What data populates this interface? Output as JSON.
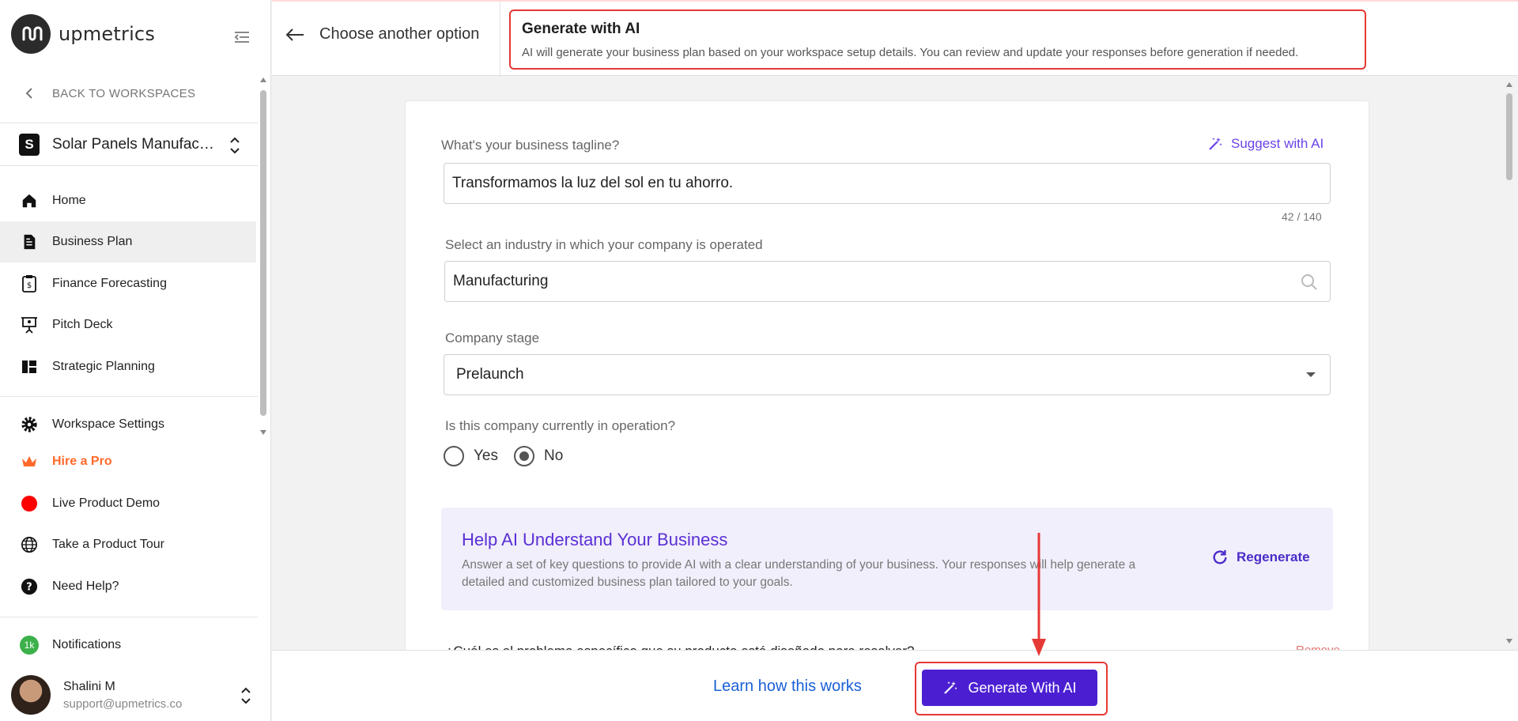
{
  "brand": {
    "name": "upmetrics"
  },
  "sidebar": {
    "back_label": "BACK TO WORKSPACES",
    "workspace": {
      "badge": "S",
      "name": "Solar Panels Manufacturing"
    },
    "items": [
      {
        "label": "Home",
        "icon": "home-icon"
      },
      {
        "label": "Business Plan",
        "icon": "document-icon",
        "active": true
      },
      {
        "label": "Finance Forecasting",
        "icon": "finance-icon"
      },
      {
        "label": "Pitch Deck",
        "icon": "presentation-icon"
      },
      {
        "label": "Strategic Planning",
        "icon": "dashboard-icon"
      }
    ],
    "secondary": [
      {
        "label": "Workspace Settings",
        "icon": "gear-icon"
      },
      {
        "label": "Hire a Pro",
        "icon": "crown-icon"
      },
      {
        "label": "Live Product Demo",
        "icon": "red-dot-icon"
      },
      {
        "label": "Take a Product Tour",
        "icon": "globe-icon"
      },
      {
        "label": "Need Help?",
        "icon": "help-icon"
      }
    ],
    "notifications": {
      "label": "Notifications",
      "badge": "1k"
    },
    "user": {
      "name": "Shalini M",
      "email": "support@upmetrics.co"
    }
  },
  "topbar": {
    "back_label": "Choose another option",
    "banner_title": "Generate with AI",
    "banner_desc": "AI will generate your business plan based on your workspace setup details. You can review and update your responses before generation if needed."
  },
  "form": {
    "tagline_label": "What's your business tagline?",
    "suggest_label": "Suggest with AI",
    "tagline_value": "Transformamos la luz del sol en tu ahorro.",
    "tagline_counter": "42 / 140",
    "industry_label": "Select an industry in which your company is operated",
    "industry_value": "Manufacturing",
    "stage_label": "Company stage",
    "stage_value": "Prelaunch",
    "operation_label": "Is this company currently in operation?",
    "operation_options": [
      "Yes",
      "No"
    ],
    "operation_selected": "No"
  },
  "help": {
    "title": "Help AI Understand Your Business",
    "desc": "Answer a set of key questions to provide AI with a clear understanding of your business. Your responses will help generate a detailed and customized business plan tailored to your goals.",
    "regen_label": "Regenerate",
    "question": "¿Cuál es el problema específico que su producto está diseñado para resolver?",
    "remove_label": "Remove"
  },
  "footer": {
    "learn_label": "Learn how this works",
    "generate_label": "Generate With AI"
  },
  "colors": {
    "accent": "#4b1fd1",
    "highlight": "#e53935",
    "pro": "#ff6a2b"
  }
}
